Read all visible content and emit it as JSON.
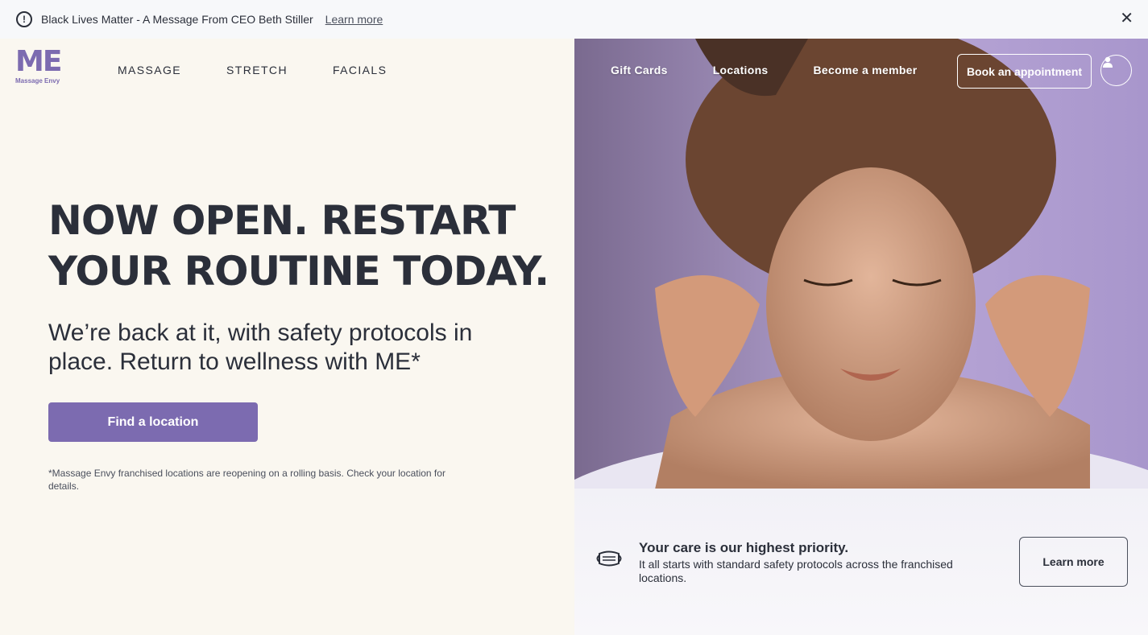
{
  "alert": {
    "icon": "exclamation-circle-icon",
    "text": "Black Lives Matter - A Message From CEO Beth Stiller",
    "link": "Learn more",
    "close": "✕"
  },
  "brand": {
    "logo_mark": "ME",
    "logo_text": "Massage Envy",
    "color": "#7c6bb0"
  },
  "nav": {
    "left": [
      "MASSAGE",
      "STRETCH",
      "FACIALS"
    ],
    "right": [
      "Gift Cards",
      "Locations",
      "Become a member"
    ],
    "book": "Book an appointment",
    "account_icon": "user-icon"
  },
  "hero": {
    "headline": "NOW OPEN. RESTART YOUR ROUTINE TODAY.",
    "subhead": "We’re back at it, with safety protocols in place. Return to wellness with ME*",
    "cta": "Find a location",
    "footnote": "*Massage Envy franchised locations are reopening on a rolling basis. Check your location for details."
  },
  "care": {
    "icon": "face-mask-icon",
    "title": "Your care is our highest priority.",
    "description": "It all starts with standard safety protocols across the franchised locations.",
    "button": "Learn more"
  }
}
